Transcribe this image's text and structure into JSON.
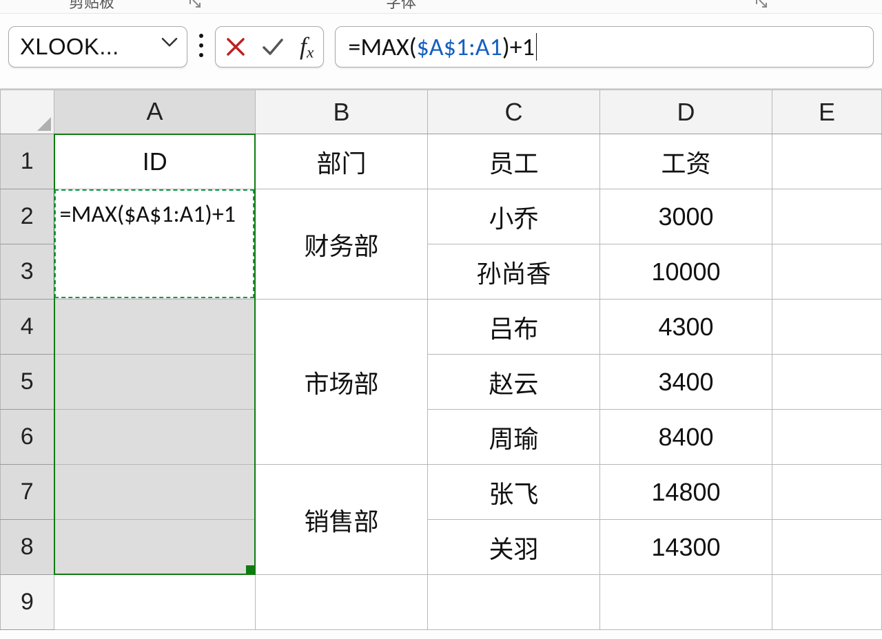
{
  "ribbon": {
    "text_left": "剪贴板",
    "text_right": "字体"
  },
  "nameBox": {
    "value": "XLOOK..."
  },
  "fxControls": {
    "cancel_tip": "Cancel",
    "enter_tip": "Enter",
    "fx_tip": "Insert Function"
  },
  "formula": {
    "prefix": "=MAX(",
    "ref": "$A$1:A1",
    "suffix": ")+1"
  },
  "columns": [
    "A",
    "B",
    "C",
    "D",
    "E"
  ],
  "rowHeaders": [
    "1",
    "2",
    "3",
    "4",
    "5",
    "6",
    "7",
    "8",
    "9"
  ],
  "tableHeaders": {
    "A": "ID",
    "B": "部门",
    "C": "员工",
    "D": "工资"
  },
  "entryFormula": "=MAX($A$1:A1)+1",
  "data": {
    "B_groups": [
      {
        "label": "财务部",
        "rows": [
          "2",
          "3"
        ]
      },
      {
        "label": "市场部",
        "rows": [
          "4",
          "5",
          "6"
        ]
      },
      {
        "label": "销售部",
        "rows": [
          "7",
          "8"
        ]
      }
    ],
    "C": {
      "2": "小乔",
      "3": "孙尚香",
      "4": "吕布",
      "5": "赵云",
      "6": "周瑜",
      "7": "张飞",
      "8": "关羽"
    },
    "D": {
      "2": "3000",
      "3": "10000",
      "4": "4300",
      "5": "3400",
      "6": "8400",
      "7": "14800",
      "8": "14300"
    }
  }
}
